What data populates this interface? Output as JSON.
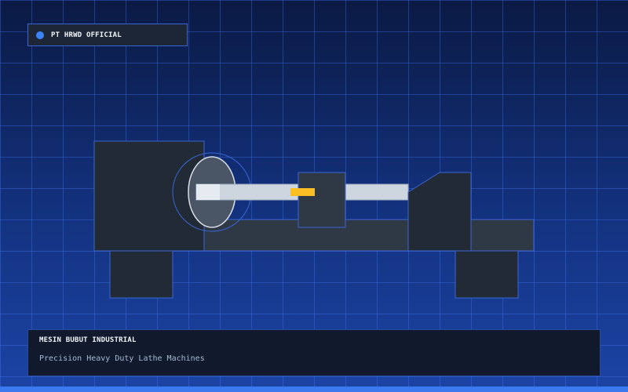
{
  "brand": {
    "label": "PT HRWD OFFICIAL",
    "dot_color": "#3b82f6"
  },
  "machine": {
    "tool_color": "#fbbf24",
    "body_color": "#222a35",
    "outline_color": "#3a66d4"
  },
  "info": {
    "title": "MESIN BUBUT INDUSTRIAL",
    "subtitle": "Precision Heavy Duty Lathe Machines"
  },
  "colors": {
    "background_top": "#0b1a44",
    "background_bottom": "#1c44a6",
    "accent_strip": "#3c78ee"
  }
}
